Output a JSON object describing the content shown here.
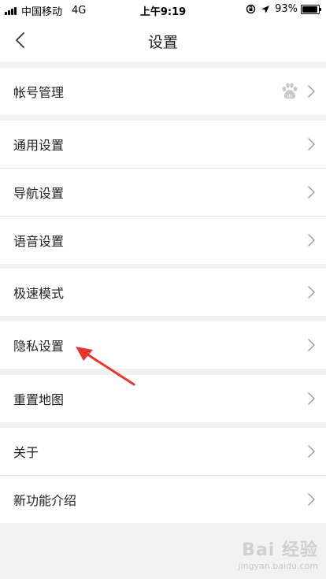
{
  "status_bar": {
    "carrier": "中国移动",
    "network": "4G",
    "time": "上午9:19",
    "battery": "93%"
  },
  "nav": {
    "title": "设置"
  },
  "groups": [
    {
      "items": [
        {
          "label": "帐号管理",
          "icon": "baidu-paw-icon"
        }
      ]
    },
    {
      "items": [
        {
          "label": "通用设置"
        },
        {
          "label": "导航设置"
        },
        {
          "label": "语音设置"
        }
      ]
    },
    {
      "items": [
        {
          "label": "极速模式"
        }
      ]
    },
    {
      "items": [
        {
          "label": "隐私设置"
        }
      ]
    },
    {
      "items": [
        {
          "label": "重置地图"
        }
      ]
    },
    {
      "items": [
        {
          "label": "关于"
        },
        {
          "label": "新功能介绍"
        }
      ]
    }
  ],
  "watermark": {
    "brand": "Bai 经验",
    "url": "jingyan.baidu.com"
  },
  "colors": {
    "background": "#f2f2f2",
    "row_background": "#ffffff",
    "annotation_arrow": "#e8362d"
  }
}
